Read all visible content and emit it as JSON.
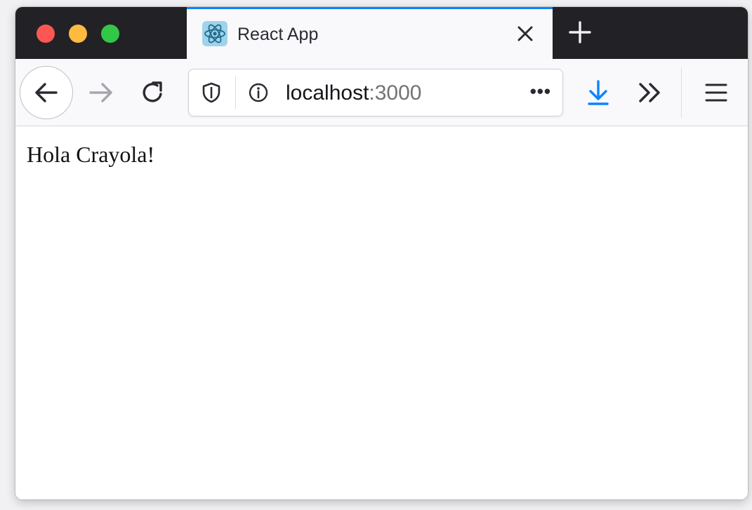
{
  "window": {
    "traffic_lights": {
      "close_color": "#fc5753",
      "minimize_color": "#fdbc40",
      "maximize_color": "#33c748"
    }
  },
  "tab": {
    "title": "React App",
    "favicon": "react-logo-icon",
    "close_icon": "close-icon",
    "active_indicator_color": "#0a84ff"
  },
  "new_tab_icon": "plus-icon",
  "navbar": {
    "back_icon": "arrow-left-icon",
    "forward_icon": "arrow-right-icon",
    "reload_icon": "reload-icon",
    "url": {
      "host": "localhost",
      "port": ":3000",
      "shield_icon": "shield-icon",
      "info_icon": "info-icon",
      "more_label": "•••"
    },
    "download_icon": "download-arrow-icon",
    "download_color": "#0a84ff",
    "overflow_icon": "chevron-double-right-icon",
    "menu_icon": "hamburger-menu-icon"
  },
  "content": {
    "text": "Hola Crayola!"
  }
}
